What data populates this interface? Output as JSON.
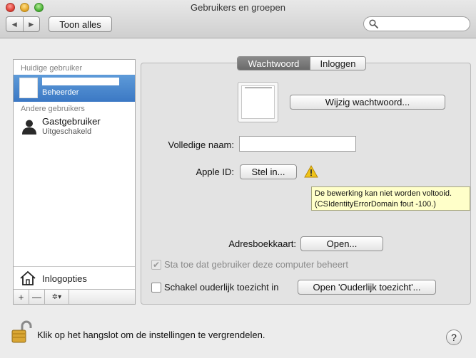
{
  "window": {
    "title": "Gebruikers en groepen"
  },
  "toolbar": {
    "back_label": "◀",
    "forward_label": "▶",
    "show_all_label": "Toon alles",
    "search_placeholder": ""
  },
  "sidebar": {
    "current_user_heading": "Huidige gebruiker",
    "current_user": {
      "role": "Beheerder"
    },
    "other_users_heading": "Andere gebruikers",
    "guest": {
      "name": "Gastgebruiker",
      "status": "Uitgeschakeld"
    },
    "login_options_label": "Inlogopties",
    "add_label": "+",
    "remove_label": "—",
    "action_label": "✲▾"
  },
  "tabs": {
    "password": "Wachtwoord",
    "login": "Inloggen",
    "active": "Wachtwoord"
  },
  "main": {
    "change_password_button": "Wijzig wachtwoord...",
    "full_name_label": "Volledige naam:",
    "full_name_value": "",
    "apple_id_label": "Apple ID:",
    "apple_id_button": "Stel in...",
    "tooltip_line1": "De bewerking kan niet worden voltooid.",
    "tooltip_line2": "(CSIdentityErrorDomain fout -100.)",
    "address_card_label": "Adresboekkaart:",
    "address_card_button": "Open...",
    "admin_checkbox_label": "Sta toe dat gebruiker deze computer beheert",
    "admin_checkbox_checked": true,
    "parental_checkbox_label": "Schakel ouderlijk toezicht in",
    "parental_checkbox_checked": false,
    "parental_button": "Open 'Ouderlijk toezicht'..."
  },
  "footer": {
    "lock_text": "Klik op het hangslot om de instellingen te vergrendelen.",
    "help_label": "?"
  },
  "colors": {
    "selection": "#3b78c4",
    "tooltip_bg": "#ffffc9",
    "warning": "#f0c419"
  }
}
